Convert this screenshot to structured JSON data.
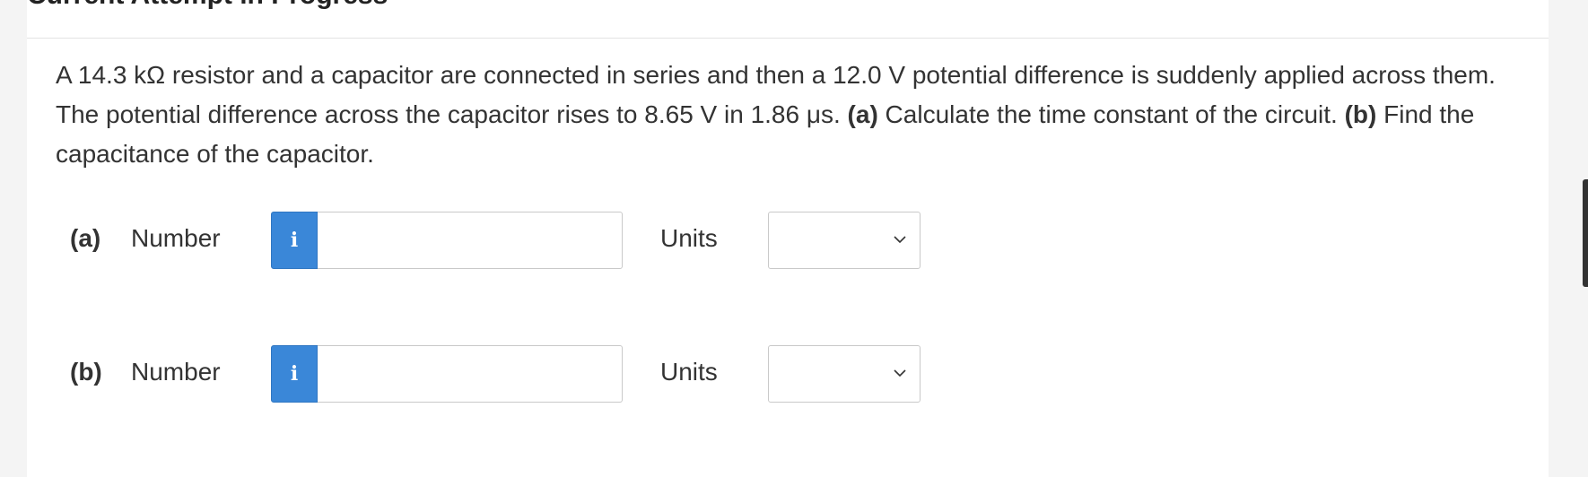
{
  "header": {
    "title": "Current Attempt in Progress"
  },
  "question": {
    "text": "A 14.3 kΩ resistor and a capacitor are connected in series and then a 12.0 V potential difference is suddenly applied across them. The potential difference across the capacitor rises to 8.65 V in 1.86 μs. ",
    "part_a_label": "(a)",
    "part_a_text": " Calculate the time constant of the circuit. ",
    "part_b_label": "(b)",
    "part_b_text": " Find the capacitance of the capacitor."
  },
  "answers": [
    {
      "part": "(a)",
      "number_label": "Number",
      "info_icon": "i",
      "number_value": "",
      "units_label": "Units",
      "units_selected": ""
    },
    {
      "part": "(b)",
      "number_label": "Number",
      "info_icon": "i",
      "number_value": "",
      "units_label": "Units",
      "units_selected": ""
    }
  ],
  "colors": {
    "accent": "#3a87d8",
    "text": "#333333",
    "border": "#c9c9c9",
    "background": "#ffffff"
  }
}
